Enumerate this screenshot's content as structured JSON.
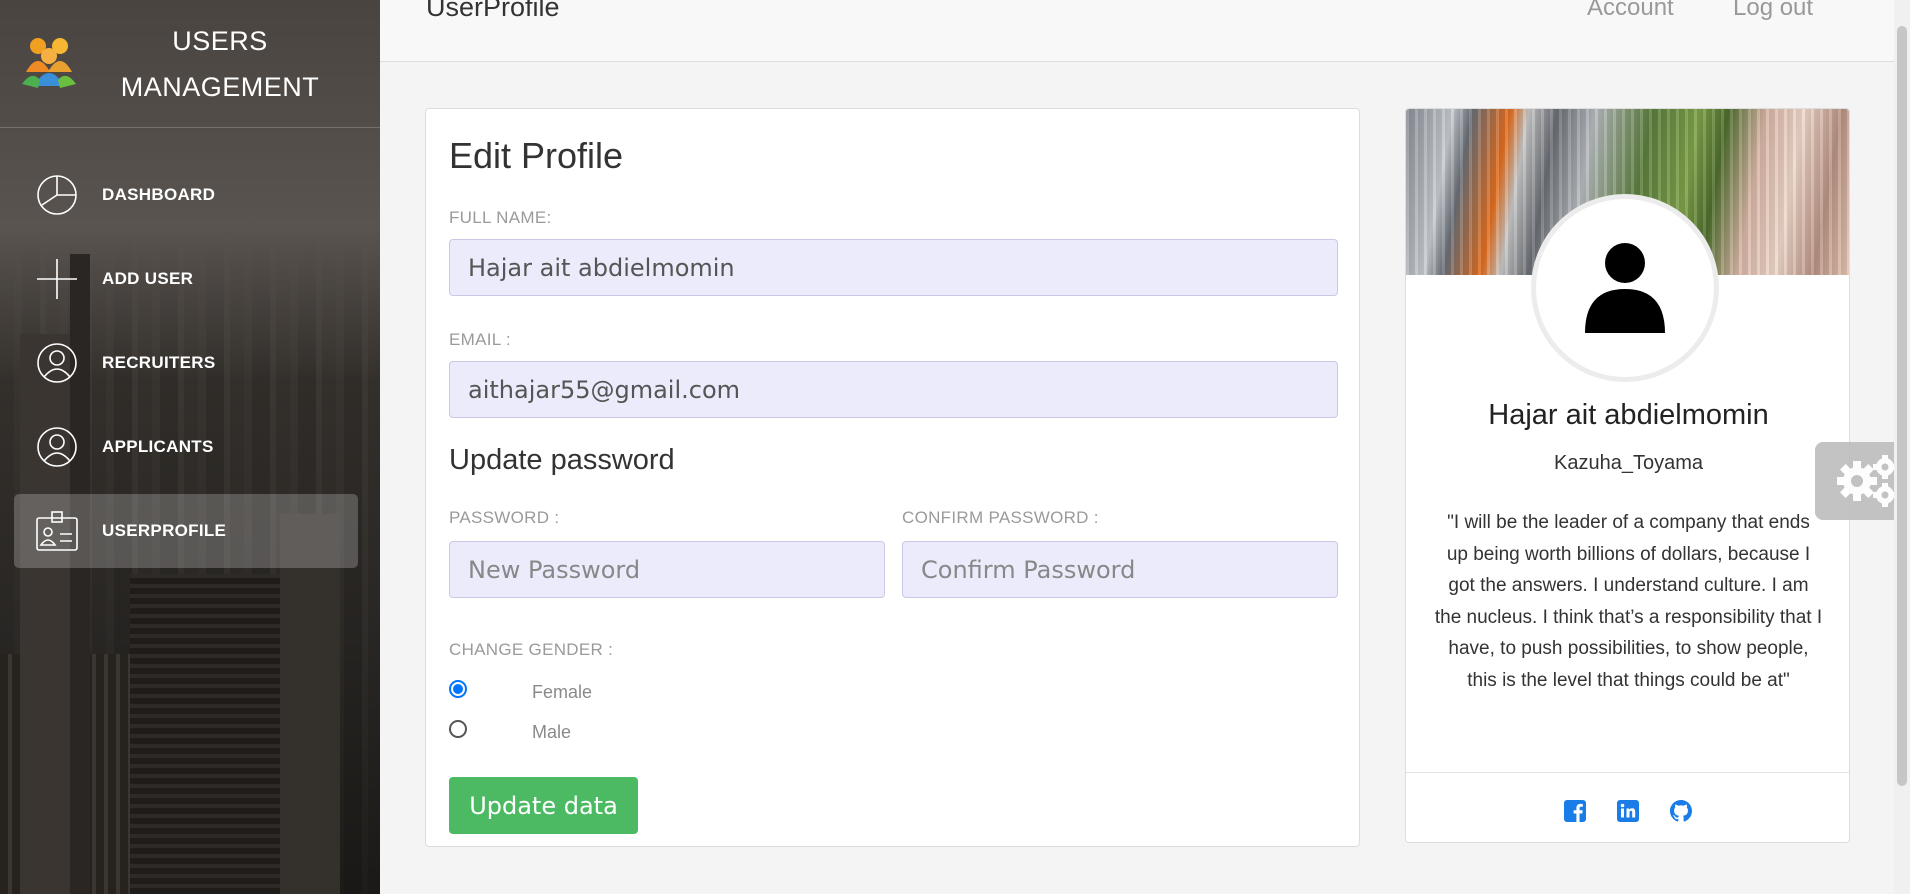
{
  "sidebar": {
    "brand": {
      "line1": "USERS",
      "line2": "MANAGEMENT"
    },
    "items": [
      {
        "label": "DASHBOARD",
        "icon": "pie-chart-icon",
        "active": false
      },
      {
        "label": "ADD USER",
        "icon": "plus-icon",
        "active": false
      },
      {
        "label": "RECRUITERS",
        "icon": "user-circle-icon",
        "active": false
      },
      {
        "label": "APPLICANTS",
        "icon": "user-circle-icon",
        "active": false
      },
      {
        "label": "USERPROFILE",
        "icon": "id-badge-icon",
        "active": true
      }
    ]
  },
  "topbar": {
    "title": "UserProfile",
    "account": "Account",
    "logout": "Log out"
  },
  "edit_form": {
    "heading": "Edit Profile",
    "full_name_label": "FULL NAME:",
    "full_name_value": "Hajar ait abdielmomin",
    "email_label": "EMAIL :",
    "email_value": "aithajar55@gmail.com",
    "password_heading": "Update password",
    "password_label": "PASSWORD :",
    "password_placeholder": "New Password",
    "confirm_label": "CONFIRM PASSWORD :",
    "confirm_placeholder": "Confirm Password",
    "gender_label": "CHANGE GENDER :",
    "gender_options": [
      {
        "label": "Female",
        "checked": true
      },
      {
        "label": "Male",
        "checked": false
      }
    ],
    "submit_label": "Update data"
  },
  "profile": {
    "name": "Hajar ait abdielmomin",
    "username": "Kazuha_Toyama",
    "quote": "\"I will be the leader of a company that ends up being worth billions of dollars, because I got the answers. I understand culture. I am the nucleus. I think that’s a responsibility that I have, to push possibilities, to show people, this is the level that things could be at\"",
    "social": [
      "facebook-icon",
      "linkedin-icon",
      "github-icon"
    ]
  },
  "colors": {
    "accent_green": "#4cba63",
    "input_bg": "#ebebfb",
    "radio_blue": "#0075ff",
    "social_blue": "#1a7ce6"
  }
}
